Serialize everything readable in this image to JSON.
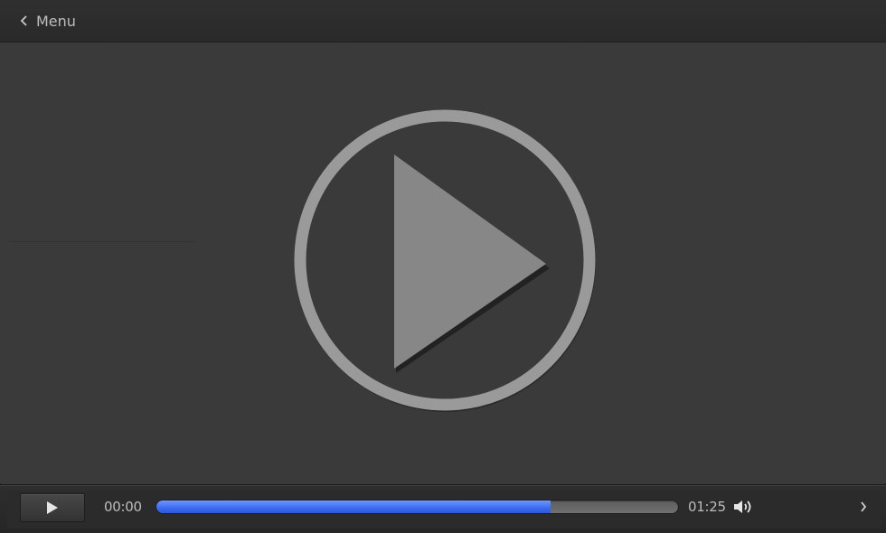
{
  "topbar": {
    "back_label": "Menu",
    "back_icon": "chevron-left-icon"
  },
  "player": {
    "big_play_icon": "play-circle-icon",
    "state": "paused"
  },
  "controls": {
    "play_icon": "play-icon",
    "current_time": "00:00",
    "duration": "01:25",
    "progress": 0.755,
    "progress_color": "#3b6bf0",
    "volume_icon": "volume-icon",
    "next_icon": "chevron-right-icon"
  },
  "colors": {
    "background": "#3a3a3a",
    "bar": "#2a2a2a",
    "icon": "#8a8a8a",
    "text": "#bdbdbd"
  }
}
